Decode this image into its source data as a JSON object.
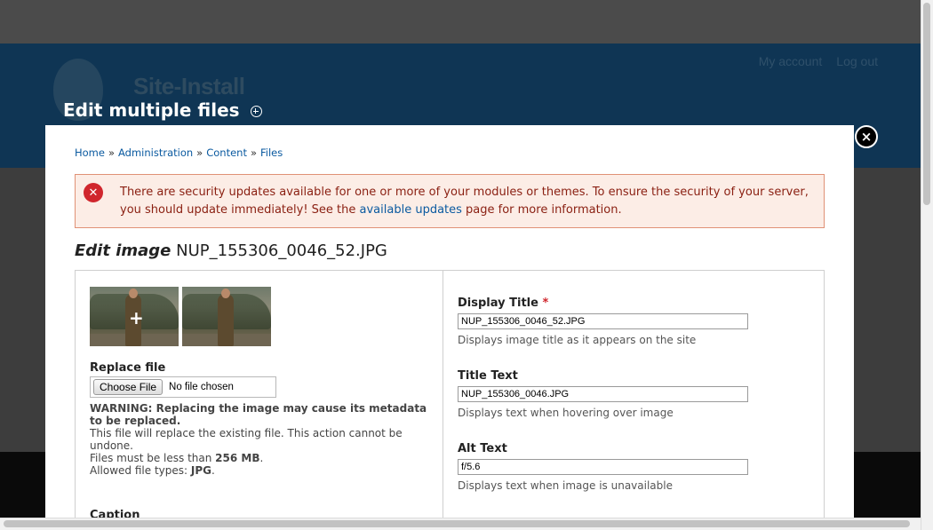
{
  "site": {
    "name": "Site-Install",
    "user_links": [
      "My account",
      "Log out"
    ]
  },
  "overlay": {
    "title": "Edit multiple files",
    "close_label": "×"
  },
  "breadcrumb": [
    "Home",
    "Administration",
    "Content",
    "Files"
  ],
  "breadcrumb_separator": "»",
  "message": {
    "before_link": "There are security updates available for one or more of your modules or themes. To ensure the security of your server, you should update immediately! See the ",
    "link": "available updates",
    "after_link": " page for more information.",
    "icon": "✕"
  },
  "heading": {
    "prefix": "Edit image",
    "filename": "NUP_155306_0046_52.JPG"
  },
  "replace_file": {
    "label": "Replace file",
    "button": "Choose File",
    "status": "No file chosen",
    "warning": "WARNING: Replacing the image may cause its metadata to be replaced.",
    "note": "This file will replace the existing file. This action cannot be undone.",
    "size_prefix": "Files must be less than ",
    "size_value": "256 MB",
    "types_prefix": "Allowed file types: ",
    "types_value": "JPG"
  },
  "caption": {
    "label": "Caption"
  },
  "fields": {
    "display_title": {
      "label": "Display Title",
      "required_mark": "*",
      "value": "NUP_155306_0046_52.JPG",
      "description": "Displays image title as it appears on the site"
    },
    "title_text": {
      "label": "Title Text",
      "value": "NUP_155306_0046.JPG",
      "description": "Displays text when hovering over image"
    },
    "alt_text": {
      "label": "Alt Text",
      "value": "f/5.6",
      "description": "Displays text when image is unavailable"
    }
  },
  "colors": {
    "header_bg": "#0f3554",
    "link": "#0b5aa0",
    "error_bg": "#fcede6",
    "error_border": "#e09176",
    "error_icon": "#d0262d"
  }
}
